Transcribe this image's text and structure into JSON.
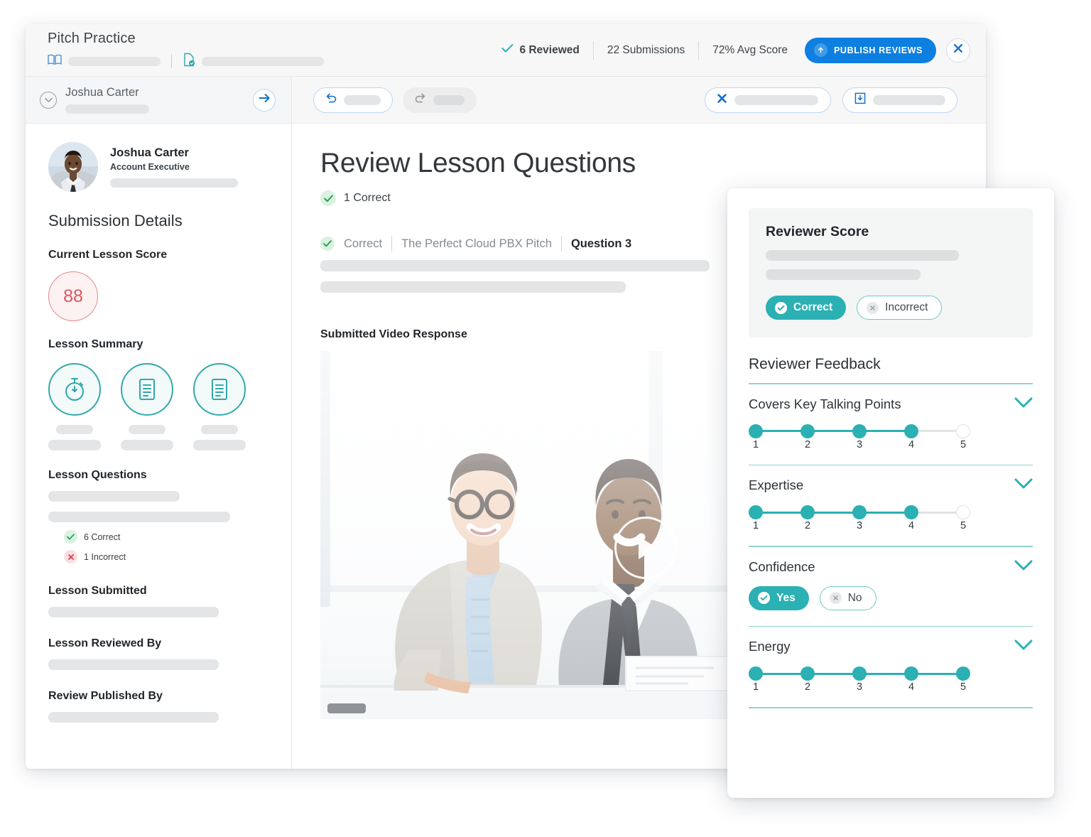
{
  "header": {
    "app_title": "Pitch Practice",
    "book_icon": "book-icon",
    "doc_check_icon": "document-check-icon",
    "stats": [
      {
        "label": "6 Reviewed",
        "icon": "check-icon",
        "bold": true
      },
      {
        "label": "22 Submissions",
        "icon": "",
        "bold": false
      },
      {
        "label": "72% Avg Score",
        "icon": "",
        "bold": false
      }
    ],
    "publish_button": "PUBLISH REVIEWS",
    "publish_icon": "upload-icon",
    "close_icon": "close-icon"
  },
  "sidebar": {
    "header": {
      "name": "Joshua Carter",
      "collapse_icon": "chevron-down-circle-icon",
      "next_icon": "arrow-right-circle-icon"
    },
    "person": {
      "name": "Joshua Carter",
      "role": "Account Executive"
    },
    "section_title": "Submission Details",
    "current_score_label": "Current Lesson Score",
    "current_score_value": "88",
    "lesson_summary_label": "Lesson Summary",
    "summary_icons": [
      "stopwatch-icon",
      "document-lines-icon",
      "document-lines-icon"
    ],
    "lesson_questions_label": "Lesson Questions",
    "question_stats": [
      {
        "label": "6 Correct",
        "icon": "check-icon",
        "state": "correct"
      },
      {
        "label": "1 Incorrect",
        "icon": "x-icon",
        "state": "incorrect"
      }
    ],
    "lesson_submitted_label": "Lesson Submitted",
    "lesson_reviewed_by_label": "Lesson Reviewed By",
    "review_published_by_label": "Review Published By"
  },
  "toolbar": {
    "undo_icon": "undo-icon",
    "redo_icon": "redo-icon",
    "discard_icon": "x-bold-icon",
    "save_icon": "save-download-icon"
  },
  "main": {
    "page_title": "Review Lesson Questions",
    "correct_count_label": "1 Correct",
    "correct_icon": "check-circle-icon",
    "breadcrumb": {
      "status": "Correct",
      "status_icon": "check-circle-icon",
      "lesson": "The Perfect Cloud PBX Pitch",
      "question": "Question 3"
    },
    "video_label": "Submitted Video Response",
    "play_icon": "play-icon"
  },
  "review_panel": {
    "score_title": "Reviewer Score",
    "score_choices": [
      {
        "label": "Correct",
        "selected": true,
        "icon": "check-circle-icon"
      },
      {
        "label": "Incorrect",
        "selected": false,
        "icon": "x-circle-icon"
      }
    ],
    "feedback_title": "Reviewer Feedback",
    "items": [
      {
        "label": "Covers Key Talking Points",
        "type": "rating",
        "scale": [
          "1",
          "2",
          "3",
          "4",
          "5"
        ],
        "value": 4,
        "chevron_icon": "chevron-down-icon"
      },
      {
        "label": "Expertise",
        "type": "rating",
        "scale": [
          "1",
          "2",
          "3",
          "4",
          "5"
        ],
        "value": 4,
        "chevron_icon": "chevron-down-icon"
      },
      {
        "label": "Confidence",
        "type": "yesno",
        "choices": [
          {
            "label": "Yes",
            "selected": true,
            "icon": "check-circle-icon"
          },
          {
            "label": "No",
            "selected": false,
            "icon": "x-circle-icon"
          }
        ],
        "chevron_icon": "chevron-down-icon"
      },
      {
        "label": "Energy",
        "type": "rating",
        "scale": [
          "1",
          "2",
          "3",
          "4",
          "5"
        ],
        "value": 5,
        "chevron_icon": "chevron-down-icon"
      }
    ]
  },
  "colors": {
    "teal": "#2bb0b3",
    "blue": "#0d7fe0",
    "score_red": "#e0565c",
    "correct_green": "#2e9e53",
    "incorrect_red": "#d9444f"
  }
}
